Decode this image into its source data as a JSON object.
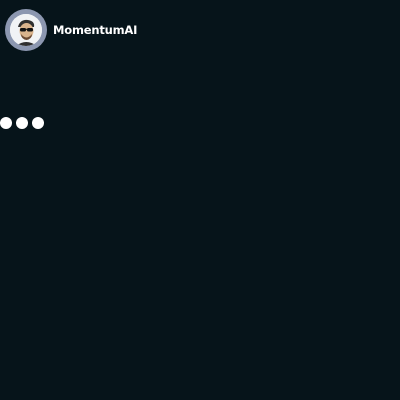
{
  "chat": {
    "bot_name": "MomentumAI",
    "avatar_icon": "person-with-sunglasses-avatar",
    "typing_indicator": {
      "state": "typing",
      "dot_count": 3
    }
  },
  "colors": {
    "background": "#06141a",
    "avatar_ring": "#8c97b0",
    "text": "#ffffff",
    "typing_dots": "#ffffff"
  }
}
